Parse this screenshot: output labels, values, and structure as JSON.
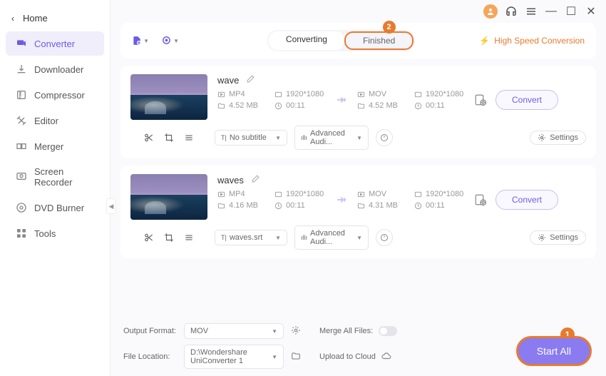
{
  "home_label": "Home",
  "sidebar": {
    "items": [
      {
        "label": "Converter"
      },
      {
        "label": "Downloader"
      },
      {
        "label": "Compressor"
      },
      {
        "label": "Editor"
      },
      {
        "label": "Merger"
      },
      {
        "label": "Screen Recorder"
      },
      {
        "label": "DVD Burner"
      },
      {
        "label": "Tools"
      }
    ]
  },
  "tabs": {
    "converting": "Converting",
    "finished": "Finished"
  },
  "callout_finished_num": "2",
  "highspeed": "High Speed Conversion",
  "files": [
    {
      "name": "wave",
      "src": {
        "fmt": "MP4",
        "res": "1920*1080",
        "size": "4.52 MB",
        "dur": "00:11"
      },
      "dst": {
        "fmt": "MOV",
        "res": "1920*1080",
        "size": "4.52 MB",
        "dur": "00:11"
      },
      "subtitle": "No subtitle",
      "audio": "Advanced Audi...",
      "settings": "Settings",
      "convert": "Convert"
    },
    {
      "name": "waves",
      "src": {
        "fmt": "MP4",
        "res": "1920*1080",
        "size": "4.16 MB",
        "dur": "00:11"
      },
      "dst": {
        "fmt": "MOV",
        "res": "1920*1080",
        "size": "4.31 MB",
        "dur": "00:11"
      },
      "subtitle": "waves.srt",
      "audio": "Advanced Audi...",
      "settings": "Settings",
      "convert": "Convert"
    }
  ],
  "bottom": {
    "output_format_label": "Output Format:",
    "output_format_value": "MOV",
    "file_location_label": "File Location:",
    "file_location_value": "D:\\Wondershare UniConverter 1",
    "merge_label": "Merge All Files:",
    "upload_label": "Upload to Cloud"
  },
  "start_all": "Start All",
  "start_badge": "1"
}
